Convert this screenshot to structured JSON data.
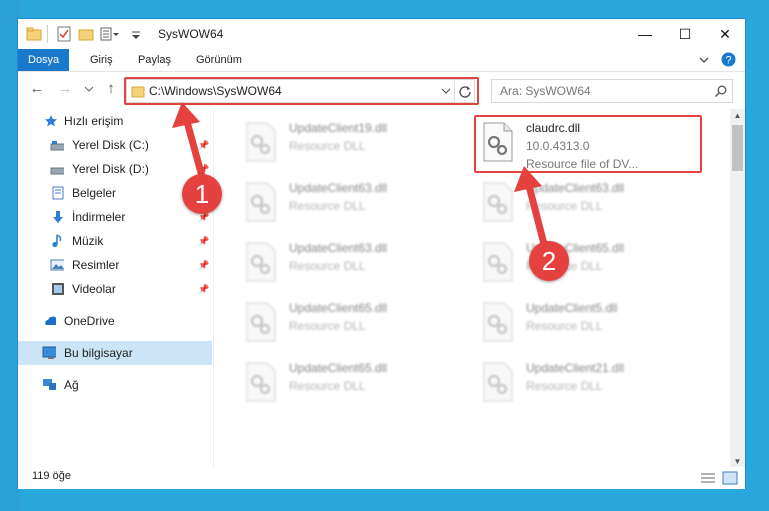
{
  "window": {
    "title": "SysWOW64",
    "controls": {
      "minimize": "—",
      "maximize": "☐",
      "close": "✕"
    }
  },
  "ribbon": {
    "tabs": [
      "Dosya",
      "Giriş",
      "Paylaş",
      "Görünüm"
    ]
  },
  "address": {
    "path": "C:\\Windows\\SysWOW64",
    "search_placeholder": "Ara: SysWOW64"
  },
  "sidebar": {
    "items": [
      {
        "label": "Hızlı erişim",
        "icon": "star-icon",
        "pinned": false
      },
      {
        "label": "Yerel Disk (C:)",
        "icon": "drive-icon",
        "pinned": true
      },
      {
        "label": "Yerel Disk (D:)",
        "icon": "drive-icon",
        "pinned": true
      },
      {
        "label": "Belgeler",
        "icon": "documents-icon",
        "pinned": true
      },
      {
        "label": "İndirmeler",
        "icon": "download-icon",
        "pinned": true
      },
      {
        "label": "Müzik",
        "icon": "music-icon",
        "pinned": true
      },
      {
        "label": "Resimler",
        "icon": "pictures-icon",
        "pinned": true
      },
      {
        "label": "Videolar",
        "icon": "video-icon",
        "pinned": true
      },
      {
        "label": "OneDrive",
        "icon": "cloud-icon",
        "pinned": false
      },
      {
        "label": "Bu bilgisayar",
        "icon": "computer-icon",
        "pinned": false
      },
      {
        "label": "Ağ",
        "icon": "network-icon",
        "pinned": false
      }
    ]
  },
  "files": {
    "left": [
      {
        "name": "UpdateClient19.dll",
        "type": "Resource DLL"
      },
      {
        "name": "UpdateClient63.dll",
        "type": "Resource DLL"
      },
      {
        "name": "UpdateClient63.dll",
        "type": "Resource DLL"
      },
      {
        "name": "UpdateClient65.dll",
        "type": "Resource DLL"
      },
      {
        "name": "UpdateClient65.dll",
        "type": "Resource DLL"
      }
    ],
    "right": [
      {
        "name": "claudrc.dll",
        "type": "10.0.4313.0",
        "desc": "Resource file of DV..."
      },
      {
        "name": "UpdateClient63.dll",
        "type": "Resource DLL"
      },
      {
        "name": "UpdateClient65.dll",
        "type": "Resource DLL"
      },
      {
        "name": "UpdateClient5.dll",
        "type": "Resource DLL"
      },
      {
        "name": "UpdateClient21.dll",
        "type": "Resource DLL"
      }
    ]
  },
  "status": {
    "count": "119 öğe"
  },
  "callouts": [
    "1",
    "2"
  ],
  "colors": {
    "accent": "#1979ca",
    "highlight": "#e3433f",
    "selection": "#cce4f7"
  }
}
